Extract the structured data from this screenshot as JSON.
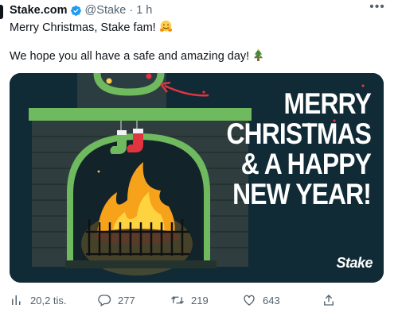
{
  "tweet": {
    "author_name": "Stake.com",
    "handle": "@Stake",
    "separator": "·",
    "time": "1 h",
    "text_line1": "Merry Christmas, Stake fam!",
    "text_line2": "We hope you all have a safe and amazing day!",
    "emoji1": "hugging-face",
    "emoji2": "christmas-tree"
  },
  "card": {
    "headline_lines": [
      "MERRY",
      "CHRISTMAS",
      "& A HAPPY",
      "NEW YEAR!"
    ],
    "logo_text": "Stake",
    "background_color": "#102a36",
    "accent_red": "#e0343f"
  },
  "actions": {
    "views": "20,2 tis.",
    "replies": "277",
    "retweets": "219",
    "likes": "643"
  },
  "icons": {
    "verified": "verified-badge-icon",
    "more": "more-icon",
    "views": "analytics-icon",
    "reply": "reply-icon",
    "retweet": "retweet-icon",
    "like": "like-icon",
    "share": "share-icon"
  }
}
